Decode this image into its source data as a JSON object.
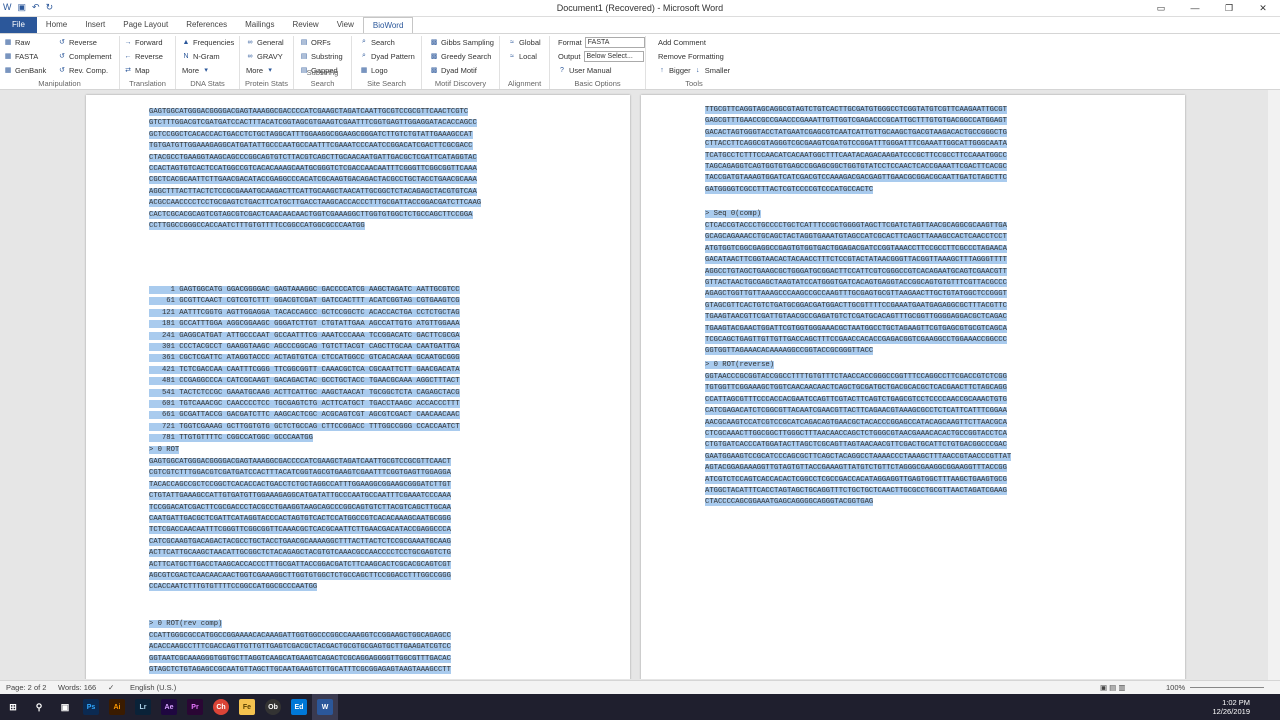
{
  "window": {
    "title": "Document1 (Recovered) - Microsoft Word"
  },
  "tabs": [
    "File",
    "Home",
    "Insert",
    "Page Layout",
    "References",
    "Mailings",
    "Review",
    "View",
    "BioWord"
  ],
  "active_tab": "BioWord",
  "ribbon": {
    "manipulation": {
      "name": "Manipulation",
      "items": [
        "Raw",
        "FASTA",
        "GenBank",
        "Reverse",
        "Complement",
        "Rev. Comp."
      ]
    },
    "translation": {
      "name": "Translation",
      "items": [
        "Forward",
        "Reverse",
        "Map"
      ]
    },
    "dna_stats": {
      "name": "DNA Stats",
      "items": [
        "Frequencies",
        "N-Gram",
        "More"
      ]
    },
    "protein_stats": {
      "name": "Protein Stats",
      "items": [
        "General",
        "GRAVY",
        "More"
      ]
    },
    "substring": {
      "name": "Substring Search",
      "items": [
        "ORFs",
        "Substring",
        "Gapped"
      ]
    },
    "site": {
      "name": "Site Search",
      "items": [
        "Search",
        "Dyad Pattern",
        "Logo"
      ]
    },
    "motif": {
      "name": "Motif Discovery",
      "items": [
        "Gibbs Sampling",
        "Greedy Search",
        "Dyad Motif"
      ]
    },
    "alignment": {
      "name": "Alignment",
      "items": [
        "Global",
        "Local"
      ]
    },
    "basic": {
      "name": "Basic Options",
      "format_label": "Format",
      "format_value": "FASTA",
      "output_label": "Output",
      "output_value": "Below Select...",
      "manual": "User Manual"
    },
    "tools": {
      "name": "Tools",
      "items": [
        "Add Comment",
        "Remove Formatting",
        "Bigger",
        "Smaller"
      ]
    }
  },
  "left_page": {
    "block1": [
      "GAGTGGCATGGGACGGGGACGAGTAAAGGCGACCCCATCGAAGCTAGATCAATTGCGTCCGCGTTCAACTCGTC",
      "GTCTTTGGACGTCGATGATCCACTTTACATCGGTAGCGTGAAGTCGAATTTCGGTGAGTTGGAGGATACACCAGCC",
      "GCTCCGGCTCACACCACTGACCTCTGCTAGGCATTTGGAAGGCGGAAGCGGGATCTTGTCTGTATTGAAAGCCAT",
      "TGTGATGTTGGAAAGAGGCATGATATTGCCCAATGCCAATTTCGAAATCCCAATCCGGACATCGACTTCGCGACC",
      "CTACGCCTGAAGGTAAGCAGCCCGGCAGTGTCTTACGTCAGCTTGCAACAATGATTGACGCTCGATTCATAGGTAC",
      "CCACTAGTGTCACTCCATGGCCGTCACACAAAGCAATGCGGGTCTCGACCAACAATTTCGGGTTCGGCGGTTCAAA",
      "CGCTCACGCAATTCTTGAACGACATACCGAGGCCCACATCGCAAGTGACAGACTACGCCTGCTACCTGAACGCAAA",
      "AGGCTTTACTTACTCTCCGCGAAATGCAAGACTTCATTGCAAGCTAACATTGCGGCTCTACAGAGCTACGTGTCAA",
      "ACGCCAACCCCTCCTGCGAGTCTGACTTCATGCTTGACCTAAGCACCACCCTTTGCGATTACCGGACGATCTTCAAG",
      "CACTCGCACGCAGTCGTAGCGTCGACTCAACAACAACTGGTCGAAAGGCTTGGTGTGGCTCTGCCAGCTTCCGGA",
      "CCTTGGCCGGGCCACCAATCTTTGTGTTTTCCGGCCATGGCGCCCAATGG"
    ],
    "block2": [
      "     1 GAGTGGCATG GGACGGGGAC GAGTAAAGGC GACCCCATCG AAGCTAGATC AATTGCGTCC",
      "    61 GCGTTCAACT CGTCGTCTTT GGACGTCGAT GATCCACTTT ACATCGGTAG CGTGAAGTCG",
      "   121 AATTTCGGTG AGTTGGAGGA TACACCAGCC GCTCCGGCTC ACACCACTGA CCTCTGCTAG",
      "   181 GCCATTTGGA AGGCGGAAGC GGGATCTTGT CTGTATTGAA AGCCATTGTG ATGTTGGAAA",
      "   241 GAGGCATGAT ATTGCCCAAT GCCAATTTCG AAATCCCAAA TCCGGACATC GACTTCGCGA",
      "   301 CCCTACGCCT GAAGGTAAGC AGCCCGGCAG TGTCTTACGT CAGCTTGCAA CAATGATTGA",
      "   361 CGCTCGATTC ATAGGTACCC ACTAGTGTCA CTCCATGGCC GTCACACAAA GCAATGCGGG",
      "   421 TCTCGACCAA CAATTTCGGG TTCGGCGGTT CAAACGCTCA CGCAATTCTT GAACGACATA",
      "   481 CCGAGGCCCA CATCGCAAGT GACAGACTAC GCCTGCTACC TGAACGCAAA AGGCTTTACT",
      "   541 TACTCTCCGC GAAATGCAAG ACTTCATTGC AAGCTAACAT TGCGGCTCTA CAGAGCTACG",
      "   601 TGTCAAACGC CAACCCCTCC TGCGAGTCTG ACTTCATGCT TGACCTAAGC ACCACCCTTT",
      "   661 GCGATTACCG GACGATCTTC AAGCACTCGC ACGCAGTCGT AGCGTCGACT CAACAACAAC",
      "   721 TGGTCGAAAG GCTTGGTGTG GCTCTGCCAG CTTCCGGACC TTTGGCCGGG CCACCAATCT",
      "   781 TTGTGTTTTC CGGCCATGGC GCCCAATGG"
    ],
    "rot_header": "> 0 ROT",
    "block3": [
      "GAGTGGCATGGGACGGGGACGAGTAAAGGCGACCCCATCGAAGCTAGATCAATTGCGTCCGCGTTCAACT",
      "CGTCGTCTTTGGACGTCGATGATCCACTTTACATCGGTAGCGTGAAGTCGAATTTCGGTGAGTTGGAGGA",
      "TACACCAGCCGCTCCGGCTCACACCACTGACCTCTGCTAGGCCATTTGGAAGGCGGAAGCGGGATCTTGT",
      "CTGTATTGAAAGCCATTGTGATGTTGGAAAGAGGCATGATATTGCCCAATGCCAATTTCGAAATCCCAAA",
      "TCCGGACATCGACTTCGCGACCCTACGCCTGAAGGTAAGCAGCCCGGCAGTGTCTTACGTCAGCTTGCAA",
      "CAATGATTGACGCTCGATTCATAGGTACCCACTAGTGTCACTCCATGGCCGTCACACAAAGCAATGCGGG",
      "TCTCGACCAACAATTTCGGGTTCGGCGGTTCAAACGCTCACGCAATTCTTGAACGACATACCGAGGCCCA",
      "CATCGCAAGTGACAGACTACGCCTGCTACCTGAACGCAAAAGGCTTTACTTACTCTCCGCGAAATGCAAG",
      "ACTTCATTGCAAGCTAACATTGCGGCTCTACAGAGCTACGTGTCAAACGCCAACCCCTCCTGCGAGTCTG",
      "ACTTCATGCTTGACCTAAGCACCACCCTTTGCGATTACCGGACGATCTTCAAGCACTCGCACGCAGTCGT",
      "AGCGTCGACTCAACAACAACTGGTCGAAAGGCTTGGTGTGGCTCTGCCAGCTTCCGGACCTTTGGCCGGG",
      "CCACCAATCTTTGTGTTTTCCGGCCATGGCGCCCAATGG"
    ],
    "rotrc_header": "> 0 ROT(rev comp)",
    "block4": [
      "CCATTGGGCGCCATGGCCGGAAAACACAAAGATTGGTGGCCCGGCCAAAGGTCCGGAAGCTGGCAGAGCC",
      "ACACCAAGCCTTTCGACCAGTTGTTGTTGAGTCGACGCTACGACTGCGTGCGAGTGCTTGAAGATCGTCC",
      "GGTAATCGCAAAGGGTGGTGCTTAGGTCAAGCATGAAGTCAGACTCGCAGGAGGGGTTGGCGTTTGACAC",
      "GTAGCTCTGTAGAGCCGCAATGTTAGCTTGCAATGAAGTCTTGCATTTCGCGGAGAGTAAGTAAAGCCTT"
    ]
  },
  "right_page": {
    "block1": [
      "TTGCGTTCAGGTAGCAGGCGTAGTCTGTCACTTGCGATGTGGGCCTCGGTATGTCGTTCAAGAATTGCGT",
      "GAGCGTTTGAACCGCCGAACCCGAAATTGTTGGTCGAGACCCGCATTGCTTTGTGTGACGGCCATGGAGT",
      "GACACTAGTGGGTACCTATGAATCGAGCGTCAATCATTGTTGCAAGCTGACGTAAGACACTGCCGGGCTG",
      "CTTACCTTCAGGCGTAGGGTCGCGAAGTCGATGTCCGGATTTGGGATTTCGAAATTGGCATTGGGCAATA",
      "TCATGCCTCTTTCCAACATCACAATGGCTTTCAATACAGACAAGATCCCGCTTCCGCCTTCCAAATGGCC",
      "TAGCAGAGGTCAGTGGTGTGAGCCGGAGCGGCTGGTGTATCCTCCAACTCACCGAAATTCGACTTCACGC",
      "TACCGATGTAAAGTGGATCATCGACGTCCAAAGACGACGAGTTGAACGCGGACGCAATTGATCTAGCTTC",
      "GATGGGGTCGCCTTTACTCGTCCCCGTCCCATGCCACTC"
    ],
    "seq_header": "> Seq 0(comp)",
    "block2": [
      "CTCACCGTACCCTGCCCCTGCTCATTTCCGCTGGGGTAGCTTCGATCTAGTTAACGCAGGCGCAAGTTGA",
      "GCAGCAGAAACCTGCAGCTACTAGGTGAAATGTAGCCATCGCACTTCAGCTTAAAGCCACTCAACCTCCT",
      "ATGTGGTCGGCGAGGCCGAGTGTGGTGACTGGAGACGATCCGGTAAACCTTCCGCCTTCGCCCTAGAACA",
      "GACATAACTTCGGTAACACTACAACCTTTCTCCGTACTATAACGGGTTACGGTTAAAGCTTTAGGGTTTT",
      "AGGCCTGTAGCTGAAGCGCTGGGATGCGGACTTCCATTCGTCGGGCCGTCACAGAATGCAGTCGAACGTT",
      "GTTACTAACTGCGAGCTAAGTATCCATGGGTGATCACAGTGAGGTACCGGCAGTGTGTTTCGTTACGCCC",
      "AGAGCTGGTTGTTAAAGCCCAAGCCGCCAAGTTTGCGAGTGCGTTAAGAACTTGCTGTATGGCTCCGGGT",
      "GTAGCGTTCACTGTCTGATGCGGACGATGGACTTGCGTTTTCCGAAATGAATGAGAGGCGCTTTACGTTC",
      "TGAAGTAACGTTCGATTGTAACGCCGAGATGTCTCGATGCACAGTTTGCGGTTGGGGAGGACGCTCAGAC",
      "TGAAGTACGAACTGGATTCGTGGTGGGAAACGCTAATGGCCTGCTAGAAGTTCGTGAGCGTGCGTCAGCA",
      "TCGCAGCTGAGTTGTTGTTGACCAGCTTTCCGAACCACACCGAGACGGTCGAAGGCCTGGAAACCGGCCC",
      "GGTGGTTAGAAACACAAAAGGCCGGTACCGCGGGTTACC"
    ],
    "rot_rev_header": "> 0 ROT(reverse)",
    "block3": [
      "GGTAACCCGCGGTACCGGCCTTTTGTGTTTCTAACCACCGGGCCGGTTTCCAGGCCTTCGACCGTCTCGG",
      "TGTGGTTCGGAAAGCTGGTCAACAACAACTCAGCTGCGATGCTGACGCACGCTCACGAACTTCTAGCAGG",
      "CCATTAGCGTTTCCCACCACGAATCCAGTTCGTACTTCAGTCTGAGCGTCCTCCCCAACCGCAAACTGTG",
      "CATCGAGACATCTCGGCGTTACAATCGAACGTTACTTCAGAACGTAAAGCGCCTCTCATTCATTTCGGAA",
      "AACGCAAGTCCATCGTCCGCATCAGACAGTGAACGCTACACCCGGAGCCATACAGCAAGTTCTTAACGCA",
      "CTCGCAAACTTGGCGGCTTGGGCTTTAACAACCAGCTCTGGGCGTAACGAAACACACTGCCGGTACCTCA",
      "CTGTGATCACCCATGGATACTTAGCTCGCAGTTAGTAACAACGTTCGACTGCATTCTGTGACGGCCCGAC",
      "GAATGGAAGTCCGCATCCCAGCGCTTCAGCTACAGGCCTAAAACCCTAAAGCTTTAACCGTAACCCGTTAT",
      "AGTACGGAGAAAGGTTGTAGTGTTACCGAAAGTTATGTCTGTTCTAGGGCGAAGGCGGAAGGTTTACCGG",
      "ATCGTCTCCAGTCACCACACTCGGCCTCGCCGACCACATAGGAGGTTGAGTGGCTTTAAGCTGAAGTGCG",
      "ATGGCTACATTTCACCTAGTAGCTGCAGGTTTCTGCTGCTCAACTTGCGCCTGCGTTAACTAGATCGAAG",
      "CTACCCCAGCGGAAATGAGCAGGGGCAGGGTACGGTGAG"
    ]
  },
  "status": {
    "page": "Page: 2 of 2",
    "words": "Words: 166",
    "language": "English (U.S.)",
    "zoom": "100%"
  },
  "tray": {
    "time": "1:02 PM",
    "date": "12/26/2019"
  },
  "taskbar_apps": [
    "Ps",
    "Ai",
    "Lr",
    "Ae",
    "Pr",
    "Ch",
    "Fe",
    "Ob",
    "Ed",
    "W"
  ]
}
